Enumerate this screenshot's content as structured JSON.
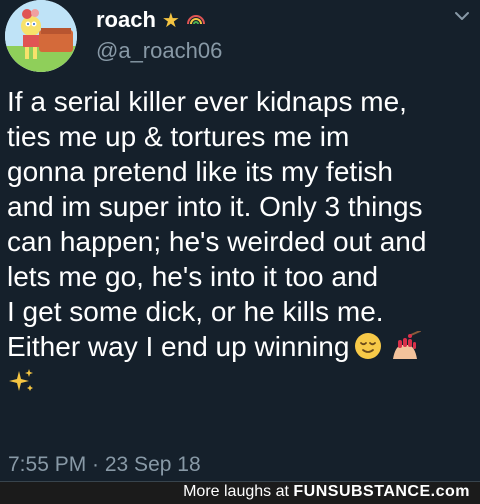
{
  "author": {
    "display_name": "roach",
    "handle": "@a_roach06",
    "avatar_icon": "spongebob-character-avatar",
    "name_emojis": [
      "star",
      "rainbow"
    ]
  },
  "tweet": {
    "lines": [
      "If a serial killer ever kidnaps me,",
      "ties me up & tortures me im",
      "gonna pretend like its my fetish",
      "and im super into it. Only 3 things",
      "can happen; he's weirded out and",
      "lets me go, he's into it too and",
      "I get some dick, or he kills me.",
      "Either way I end up winning"
    ],
    "trailing_emojis": [
      "relieved-face",
      "nail-polish",
      "sparkles"
    ],
    "timestamp": "7:55 PM · 23 Sep 18"
  },
  "footer": {
    "prefix": "More laughs at",
    "brand": "FUNSUBSTANCE.com"
  },
  "colors": {
    "background": "#15202b",
    "text": "#ffffff",
    "muted": "#8899a6",
    "footer_bg": "#1b1b1b"
  }
}
